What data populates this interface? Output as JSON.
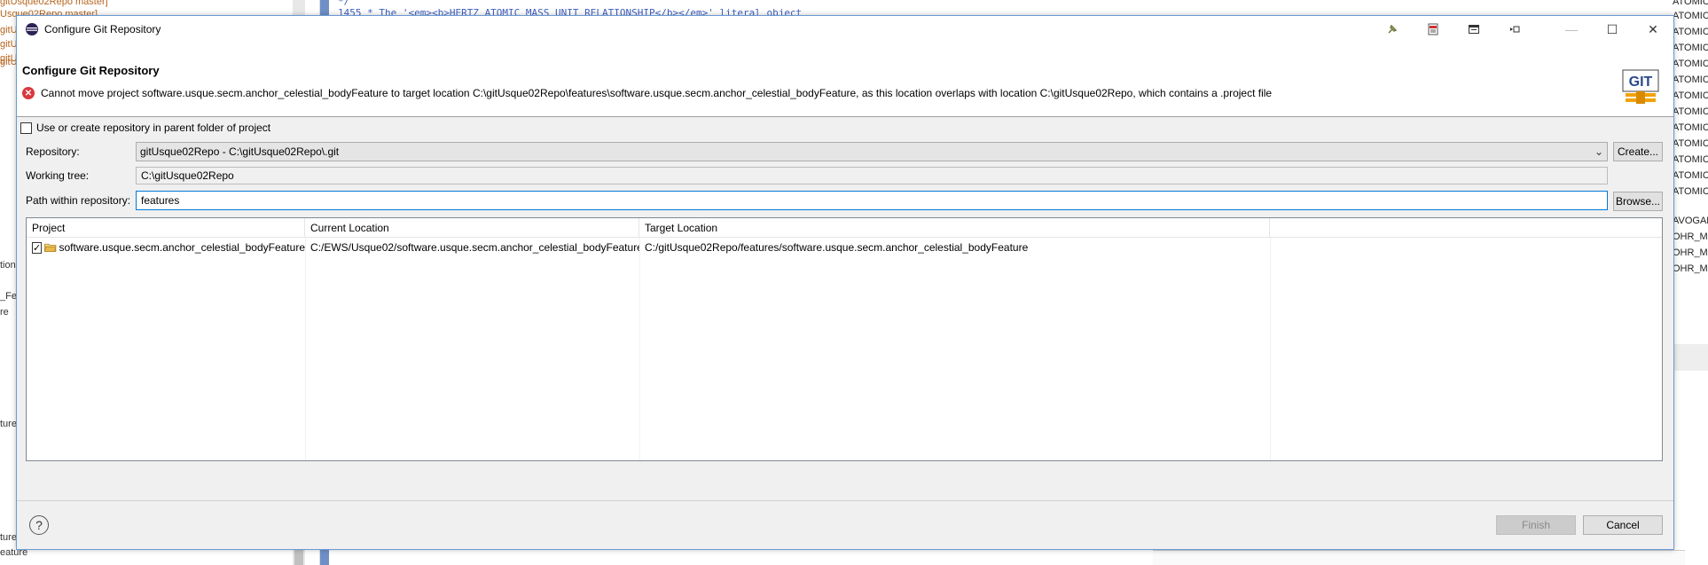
{
  "background": {
    "left_lines": [
      "gitUsque02Repo master]",
      "Usque02Repo master]",
      "gitU",
      "gitU",
      "gitU",
      "gitU",
      "tion",
      "_Fea",
      "re",
      "ture",
      "ture",
      "eature"
    ],
    "code_lines": [
      "  */",
      "1455     * The '<em><b>HERTZ ATOMIC MASS UNIT RELATIONSHIP</b></em>' literal object"
    ],
    "right_lines": [
      "ATOMIC",
      "ATOMIC",
      "ATOMIC",
      "ATOMIC",
      "ATOMIC",
      "ATOMIC",
      "ATOMIC",
      "ATOMIC",
      "ATOMIC",
      "ATOMIC",
      "ATOMIC",
      "ATOMIC",
      "ATOMIC",
      "AVOGAD",
      "OHR_M",
      "OHR_M",
      "OHR_M"
    ]
  },
  "dialog": {
    "window_title": "Configure Git Repository",
    "title_tools": [
      "pin-icon",
      "pdf-icon",
      "window-icon",
      "collapse-icon"
    ],
    "window_buttons": {
      "minimize": "—",
      "maximize": "☐",
      "close": "✕"
    },
    "header": {
      "title": "Configure Git Repository",
      "error_message": "Cannot move project software.usque.secm.anchor_celestial_bodyFeature to target location C:\\gitUsque02Repo\\features\\software.usque.secm.anchor_celestial_bodyFeature, as this location overlaps with location C:\\gitUsque02Repo, which contains a .project file",
      "logo_text": "GIT"
    },
    "use_parent_checkbox": {
      "label": "Use or create repository in parent folder of project",
      "checked": false
    },
    "repository": {
      "label": "Repository:",
      "value": "gitUsque02Repo - C:\\gitUsque02Repo\\.git",
      "create_button": "Create..."
    },
    "working_tree": {
      "label": "Working tree:",
      "value": "C:\\gitUsque02Repo"
    },
    "path_within_repo": {
      "label": "Path within repository:",
      "value": "features",
      "browse_button": "Browse..."
    },
    "table": {
      "columns": [
        "Project",
        "Current Location",
        "Target Location"
      ],
      "rows": [
        {
          "checked": true,
          "project": "software.usque.secm.anchor_celestial_bodyFeature",
          "current_location": "C:/EWS/Usque02/software.usque.secm.anchor_celestial_bodyFeature",
          "target_location": "C:/gitUsque02Repo/features/software.usque.secm.anchor_celestial_bodyFeature"
        }
      ]
    },
    "footer": {
      "help": "?",
      "finish_button": "Finish",
      "cancel_button": "Cancel"
    }
  },
  "colors": {
    "error": "#d9393e",
    "dialog_border": "#6b9ad6",
    "focus_border": "#0078d7",
    "git_logo_orange": "#f0a30a"
  }
}
